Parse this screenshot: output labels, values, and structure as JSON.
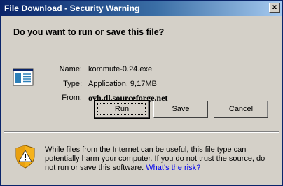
{
  "window": {
    "title": "File Download - Security Warning",
    "close_glyph": "x"
  },
  "question": "Do you want to run or save this file?",
  "file_info": {
    "name_label": "Name:",
    "name_value": "kommute-0.24.exe",
    "type_label": "Type:",
    "type_value": "Application, 9,17MB",
    "from_label": "From:",
    "from_value": "ovh.dl.sourceforge.net"
  },
  "buttons": {
    "run": "Run",
    "save": "Save",
    "cancel": "Cancel"
  },
  "warning": {
    "text": "While files from the Internet can be useful, this file type can potentially harm your computer. If you do not trust the source, do not run or save this software. ",
    "link": "What's the risk?"
  },
  "icons": {
    "file": "application-window-icon",
    "shield": "security-shield-icon"
  },
  "colors": {
    "titlebar_start": "#0a246a",
    "titlebar_end": "#a6caf0",
    "dialog_bg": "#d4d0c8",
    "link": "#0000ee"
  }
}
